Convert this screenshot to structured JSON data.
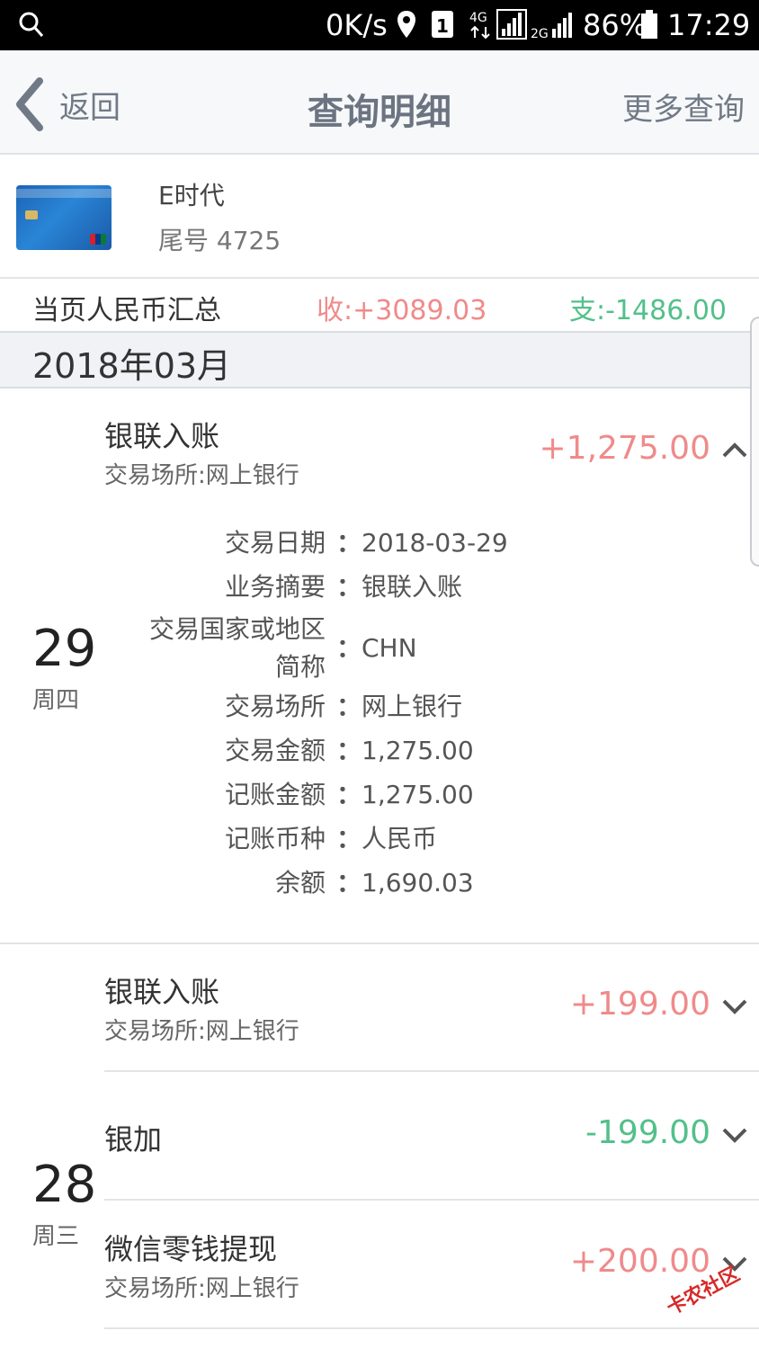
{
  "status_bar": {
    "network_speed": "0K/s",
    "battery": "86%",
    "time": "17:29",
    "sim_badge": "1",
    "network_4g": "4G",
    "network_2g": "2G"
  },
  "header": {
    "back_label": "返回",
    "title": "查询明细",
    "more_label": "更多查询"
  },
  "card": {
    "name": "E时代",
    "tail": "尾号 4725"
  },
  "summary": {
    "label": "当页人民币汇总",
    "income": "收:+3089.03",
    "expense": "支:-1486.00"
  },
  "month": "2018年03月",
  "days": [
    {
      "day": "29",
      "weekday": "周四",
      "transactions": [
        {
          "title": "银联入账",
          "sub": "交易场所:网上银行",
          "amount": "+1,275.00",
          "expanded": true,
          "details": [
            {
              "label": "交易日期",
              "value": "2018-03-29"
            },
            {
              "label": "业务摘要",
              "value": "银联入账"
            },
            {
              "label": "交易国家或地区",
              "label2": "简称",
              "value": "CHN"
            },
            {
              "label": "交易场所",
              "value": "网上银行"
            },
            {
              "label": "交易金额",
              "value": "1,275.00"
            },
            {
              "label": "记账金额",
              "value": "1,275.00"
            },
            {
              "label": "记账币种",
              "value": "人民币"
            },
            {
              "label": "余额",
              "value": "1,690.03"
            }
          ]
        }
      ]
    },
    {
      "day": "28",
      "weekday": "周三",
      "transactions": [
        {
          "title": "银联入账",
          "sub": "交易场所:网上银行",
          "amount": "+199.00",
          "expanded": false
        },
        {
          "title": "银加",
          "sub": "",
          "amount": "-199.00",
          "expanded": false
        },
        {
          "title": "微信零钱提现",
          "sub": "交易场所:网上银行",
          "amount": "+200.00",
          "expanded": false
        }
      ]
    }
  ],
  "colon": "：",
  "watermark": "卡农社区",
  "colors": {
    "income": "#f08a8a",
    "expense": "#52c08a",
    "header_text": "#707a86"
  }
}
